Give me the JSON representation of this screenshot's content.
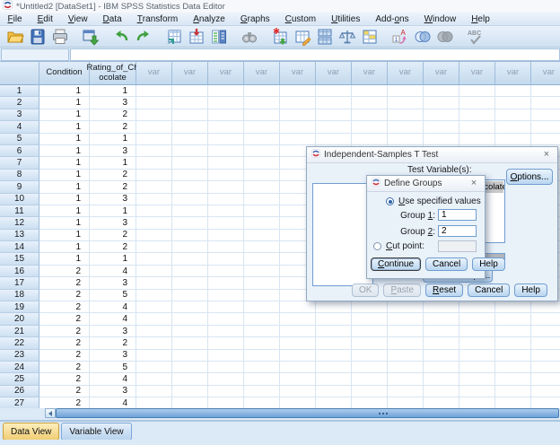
{
  "window": {
    "title": "*Untitled2 [DataSet1] - IBM SPSS Statistics Data Editor"
  },
  "menu": {
    "items": [
      {
        "label": "File",
        "u": 0
      },
      {
        "label": "Edit",
        "u": 0
      },
      {
        "label": "View",
        "u": 0
      },
      {
        "label": "Data",
        "u": 0
      },
      {
        "label": "Transform",
        "u": 0
      },
      {
        "label": "Analyze",
        "u": 0
      },
      {
        "label": "Graphs",
        "u": 0
      },
      {
        "label": "Custom",
        "u": 0
      },
      {
        "label": "Utilities",
        "u": 0
      },
      {
        "label": "Add-ons",
        "u": 4
      },
      {
        "label": "Window",
        "u": 0
      },
      {
        "label": "Help",
        "u": 0
      }
    ]
  },
  "toolbar": {
    "icons": [
      "open-data-document",
      "save",
      "print",
      "recall-recently-used-dialogs",
      "undo",
      "redo",
      "go-to-case",
      "go-to-variable",
      "variables",
      "find",
      "insert-cases",
      "insert-variable",
      "split-file",
      "weight-cases",
      "value-labels",
      "show-value-labels",
      "use-variable-sets",
      "show-all-variables",
      "spell-check"
    ]
  },
  "cell_editor": {
    "reference": "",
    "value": ""
  },
  "grid": {
    "columns": [
      {
        "name": "Condition",
        "line1": "Condition",
        "line2": ""
      },
      {
        "name": "Rating_of_Chocolate",
        "line1": "Rating_of_Ch",
        "line2": "ocolate"
      }
    ],
    "var_header": "var",
    "var_column_count": 12,
    "rows": [
      [
        1,
        1,
        1
      ],
      [
        2,
        1,
        3
      ],
      [
        3,
        1,
        2
      ],
      [
        4,
        1,
        2
      ],
      [
        5,
        1,
        1
      ],
      [
        6,
        1,
        3
      ],
      [
        7,
        1,
        1
      ],
      [
        8,
        1,
        2
      ],
      [
        9,
        1,
        2
      ],
      [
        10,
        1,
        3
      ],
      [
        11,
        1,
        1
      ],
      [
        12,
        1,
        3
      ],
      [
        13,
        1,
        2
      ],
      [
        14,
        1,
        2
      ],
      [
        15,
        1,
        1
      ],
      [
        16,
        2,
        4
      ],
      [
        17,
        2,
        3
      ],
      [
        18,
        2,
        5
      ],
      [
        19,
        2,
        4
      ],
      [
        20,
        2,
        4
      ],
      [
        21,
        2,
        3
      ],
      [
        22,
        2,
        2
      ],
      [
        23,
        2,
        3
      ],
      [
        24,
        2,
        5
      ],
      [
        25,
        2,
        4
      ],
      [
        26,
        2,
        3
      ],
      [
        27,
        2,
        4
      ]
    ]
  },
  "tabs": {
    "data_view": "Data View",
    "variable_view": "Variable View"
  },
  "ttest_dialog": {
    "title": "Independent-Samples T Test",
    "close_label": "×",
    "test_variables_label": "Test Variable(s):",
    "test_variables": [
      "Rating_of_Chocolate"
    ],
    "options": {
      "label": "Options...",
      "u": 0
    },
    "grouping_variable_value": "",
    "define_groups_button": {
      "label": "Define Groups...",
      "u": -1
    },
    "buttons": [
      {
        "label": "OK",
        "u": -1,
        "disabled": true
      },
      {
        "label": "Paste",
        "u": 0,
        "disabled": true
      },
      {
        "label": "Reset",
        "u": 0
      },
      {
        "label": "Cancel",
        "u": -1
      },
      {
        "label": "Help",
        "u": -1
      }
    ]
  },
  "define_groups_dialog": {
    "title": "Define Groups",
    "close_label": "×",
    "use_specified": {
      "label": "Use specified values",
      "u": 0,
      "selected": true
    },
    "group1": {
      "label": "Group 1:",
      "u": 6,
      "value": "1"
    },
    "group2": {
      "label": "Group 2:",
      "u": 6,
      "value": "2"
    },
    "cut_point": {
      "label": "Cut point:",
      "u": 0,
      "selected": false,
      "value": ""
    },
    "buttons": [
      {
        "label": "Continue",
        "u": 0,
        "focused": true
      },
      {
        "label": "Cancel",
        "u": -1
      },
      {
        "label": "Help",
        "u": -1
      }
    ]
  },
  "colors": {
    "accent_blue": "#6f9dcf",
    "header_blue": "#c4daee",
    "active_tab_yellow": "#f0cd74",
    "scrollbar_blue": "#6da2d8"
  }
}
